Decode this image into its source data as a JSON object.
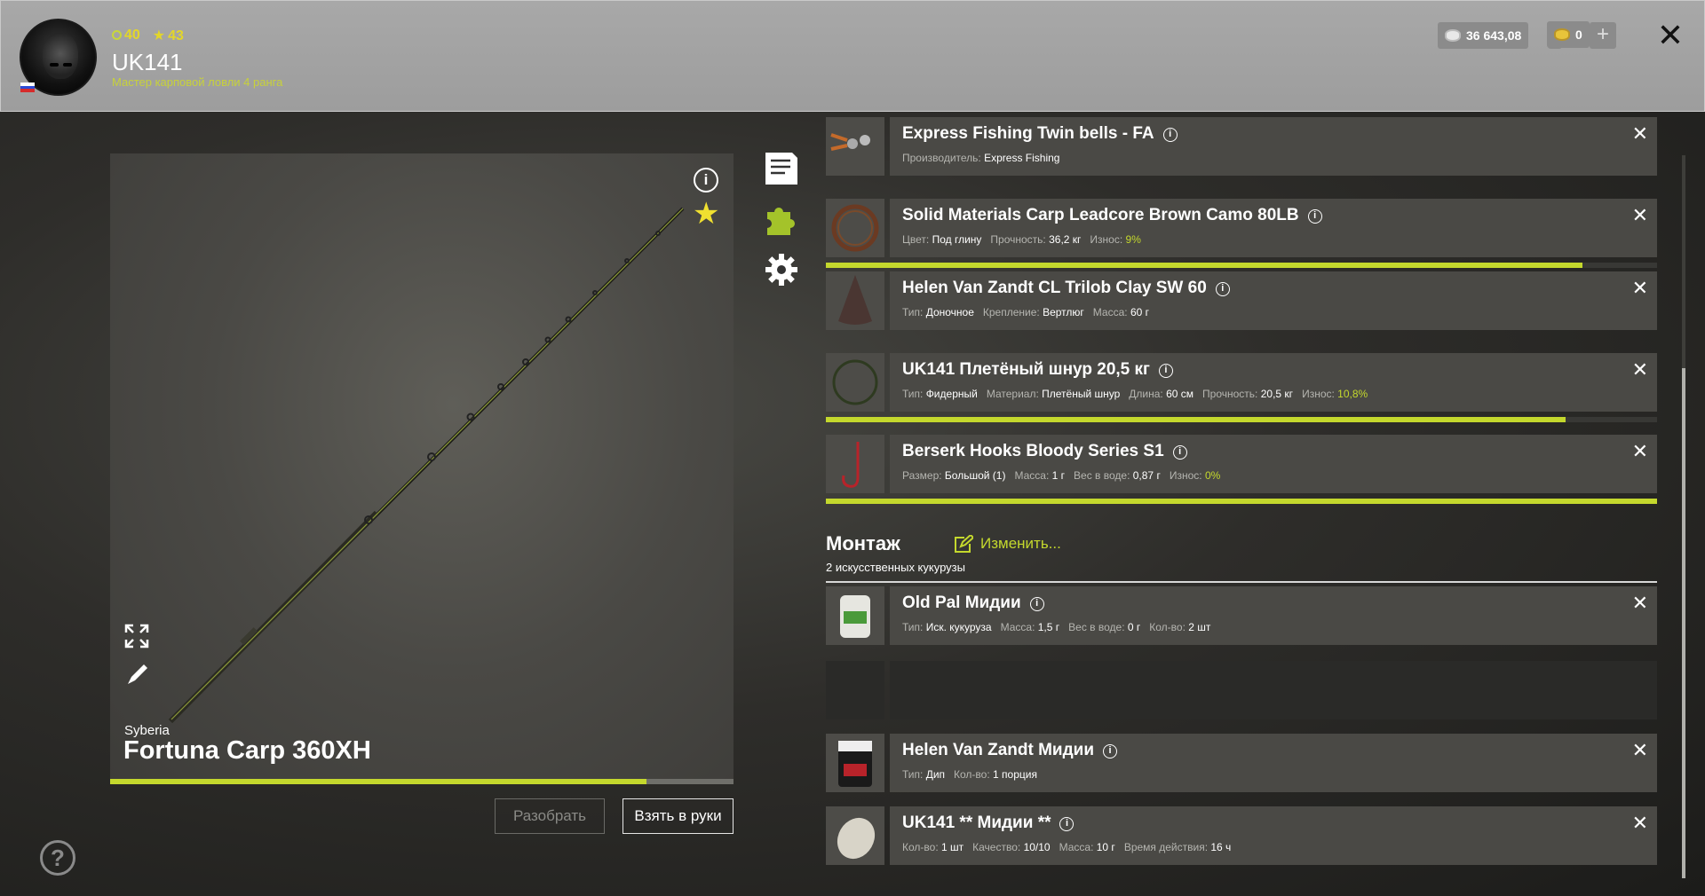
{
  "player": {
    "level": "40",
    "stars": "43",
    "name": "UK141",
    "rank": "Мастер карповой ловли 4 ранга"
  },
  "currency": {
    "silver": "36 643,08",
    "gold": "0",
    "add_label": "+"
  },
  "close_label": "✕",
  "rod": {
    "brand": "Syberia",
    "name": "Fortuna Carp 360XH",
    "wear_fraction": 0.86,
    "disassemble_label": "Разобрать",
    "take_label": "Взять в руки"
  },
  "items": [
    {
      "title": "Express Fishing Twin bells - FA",
      "props": [
        {
          "k": "Производитель:",
          "v": "Express Fishing"
        }
      ]
    },
    {
      "title": "Solid Materials Carp Leadcore Brown Camo 80LB",
      "props": [
        {
          "k": "Цвет:",
          "v": "Под глину"
        },
        {
          "k": "Прочность:",
          "v": "36,2 кг"
        },
        {
          "k": "Износ:",
          "v": "9%",
          "g": true
        }
      ],
      "bar": 0.91
    },
    {
      "title": "Helen Van Zandt CL Trilob Clay SW 60",
      "props": [
        {
          "k": "Тип:",
          "v": "Доночное"
        },
        {
          "k": "Крепление:",
          "v": "Вертлюг"
        },
        {
          "k": "Масса:",
          "v": "60 г"
        }
      ]
    },
    {
      "title": "UK141 Плетёный шнур 20,5 кг",
      "props": [
        {
          "k": "Тип:",
          "v": "Фидерный"
        },
        {
          "k": "Материал:",
          "v": "Плетёный шнур"
        },
        {
          "k": "Длина:",
          "v": "60 см"
        },
        {
          "k": "Прочность:",
          "v": "20,5 кг"
        },
        {
          "k": "Износ:",
          "v": "10,8%",
          "g": true
        }
      ],
      "bar": 0.89
    },
    {
      "title": "Berserk Hooks Bloody Series S1",
      "props": [
        {
          "k": "Размер:",
          "v": "Большой (1)"
        },
        {
          "k": "Масса:",
          "v": "1 г"
        },
        {
          "k": "Вес в воде:",
          "v": "0,87 г"
        },
        {
          "k": "Износ:",
          "v": "0%",
          "g": true
        }
      ],
      "bar": 1.0
    }
  ],
  "rig": {
    "title": "Монтаж",
    "edit_label": "Изменить...",
    "subtitle": "2 искусственных кукурузы"
  },
  "rig_items": [
    {
      "title": "Old Pal Мидии",
      "props": [
        {
          "k": "Тип:",
          "v": "Иск. кукуруза"
        },
        {
          "k": "Масса:",
          "v": "1,5 г"
        },
        {
          "k": "Вес в воде:",
          "v": "0 г"
        },
        {
          "k": "Кол-во:",
          "v": "2 шт"
        }
      ]
    },
    {
      "title": "Helen Van Zandt Мидии",
      "props": [
        {
          "k": "Тип:",
          "v": "Дип"
        },
        {
          "k": "Кол-во:",
          "v": "1 порция"
        }
      ]
    },
    {
      "title": "UK141 ** Мидии **",
      "props": [
        {
          "k": "Кол-во:",
          "v": "1 шт"
        },
        {
          "k": "Качество:",
          "v": "10/10"
        },
        {
          "k": "Масса:",
          "v": "10 г"
        },
        {
          "k": "Время действия:",
          "v": "16 ч"
        }
      ]
    }
  ],
  "help_label": "?",
  "icons": {
    "info": "info-icon",
    "favorite": "star-icon",
    "notes": "document-icon",
    "parts": "puzzle-icon",
    "settings": "gear-icon",
    "expand": "expand-icon",
    "edit": "brush-icon"
  },
  "colors": {
    "accent": "#c4d82d",
    "gold": "#e3d629"
  }
}
